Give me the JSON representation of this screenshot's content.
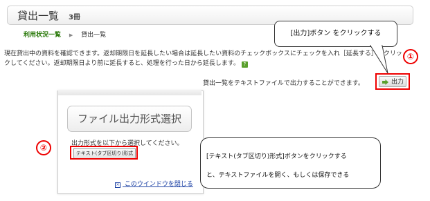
{
  "header": {
    "title": "貸出一覧",
    "count": "3冊"
  },
  "breadcrumb": {
    "link": "利用状況一覧",
    "separator": "▶",
    "current": "貸出一覧"
  },
  "instructions": {
    "line": "現在貸出中の資料を確認できます。返却期限日を延長したい場合は延長したい資料のチェックボックスにチェックを入れ［延長する］をクリックしてください。返却期限日より前に延長すると、処理を行った日から延長します。",
    "help_icon_text": "?"
  },
  "export": {
    "text": "貸出一覧をテキストファイルで出力することができます。",
    "button_label": "出力"
  },
  "callout1": {
    "text": "[出力]ボタン をクリックする"
  },
  "markers": {
    "one": "①",
    "two": "②"
  },
  "dialog": {
    "format_button": "ファイル出力形式選択",
    "description": "出力形式を以下から選択してください。",
    "tsv_button": "テキスト(タブ区切り)形式",
    "close_link": "このウインドウを閉じる",
    "close_icon_text": "×"
  },
  "callout2": {
    "line1": "[テキスト(タブ区切り)形式]ボタンをクリックする",
    "line2": "と、テキストファイルを開く、もしくは保存できる"
  },
  "colors": {
    "accent_red": "#ee0000",
    "link_green": "#2b7a0b",
    "link_blue": "#1a3fa3"
  }
}
